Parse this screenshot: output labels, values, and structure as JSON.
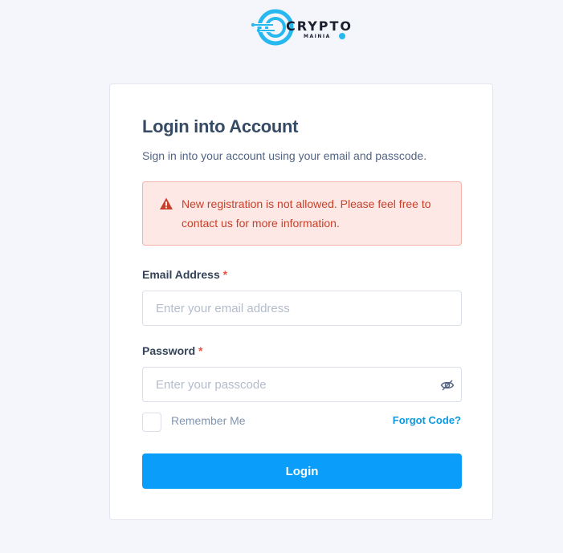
{
  "brand": {
    "name": "CRYPTO",
    "tagline": "MAINIA",
    "accent_color": "#27b8f0"
  },
  "login": {
    "title": "Login into Account",
    "subtitle": "Sign in into your account using your email and passcode.",
    "alert": {
      "icon": "warning-triangle-icon",
      "text": "New registration is not allowed. Please feel free to contact us for more information.",
      "color": "#c7402a"
    },
    "email": {
      "label": "Email Address",
      "required_mark": "*",
      "value": "",
      "placeholder": "Enter your email address"
    },
    "password": {
      "label": "Password",
      "required_mark": "*",
      "value": "",
      "placeholder": "Enter your passcode",
      "toggle_icon": "eye-slash-icon"
    },
    "remember_me": {
      "label": "Remember Me",
      "checked": false
    },
    "forgot_link": "Forgot Code?",
    "submit_label": "Login",
    "primary_color": "#0a9dfa"
  }
}
